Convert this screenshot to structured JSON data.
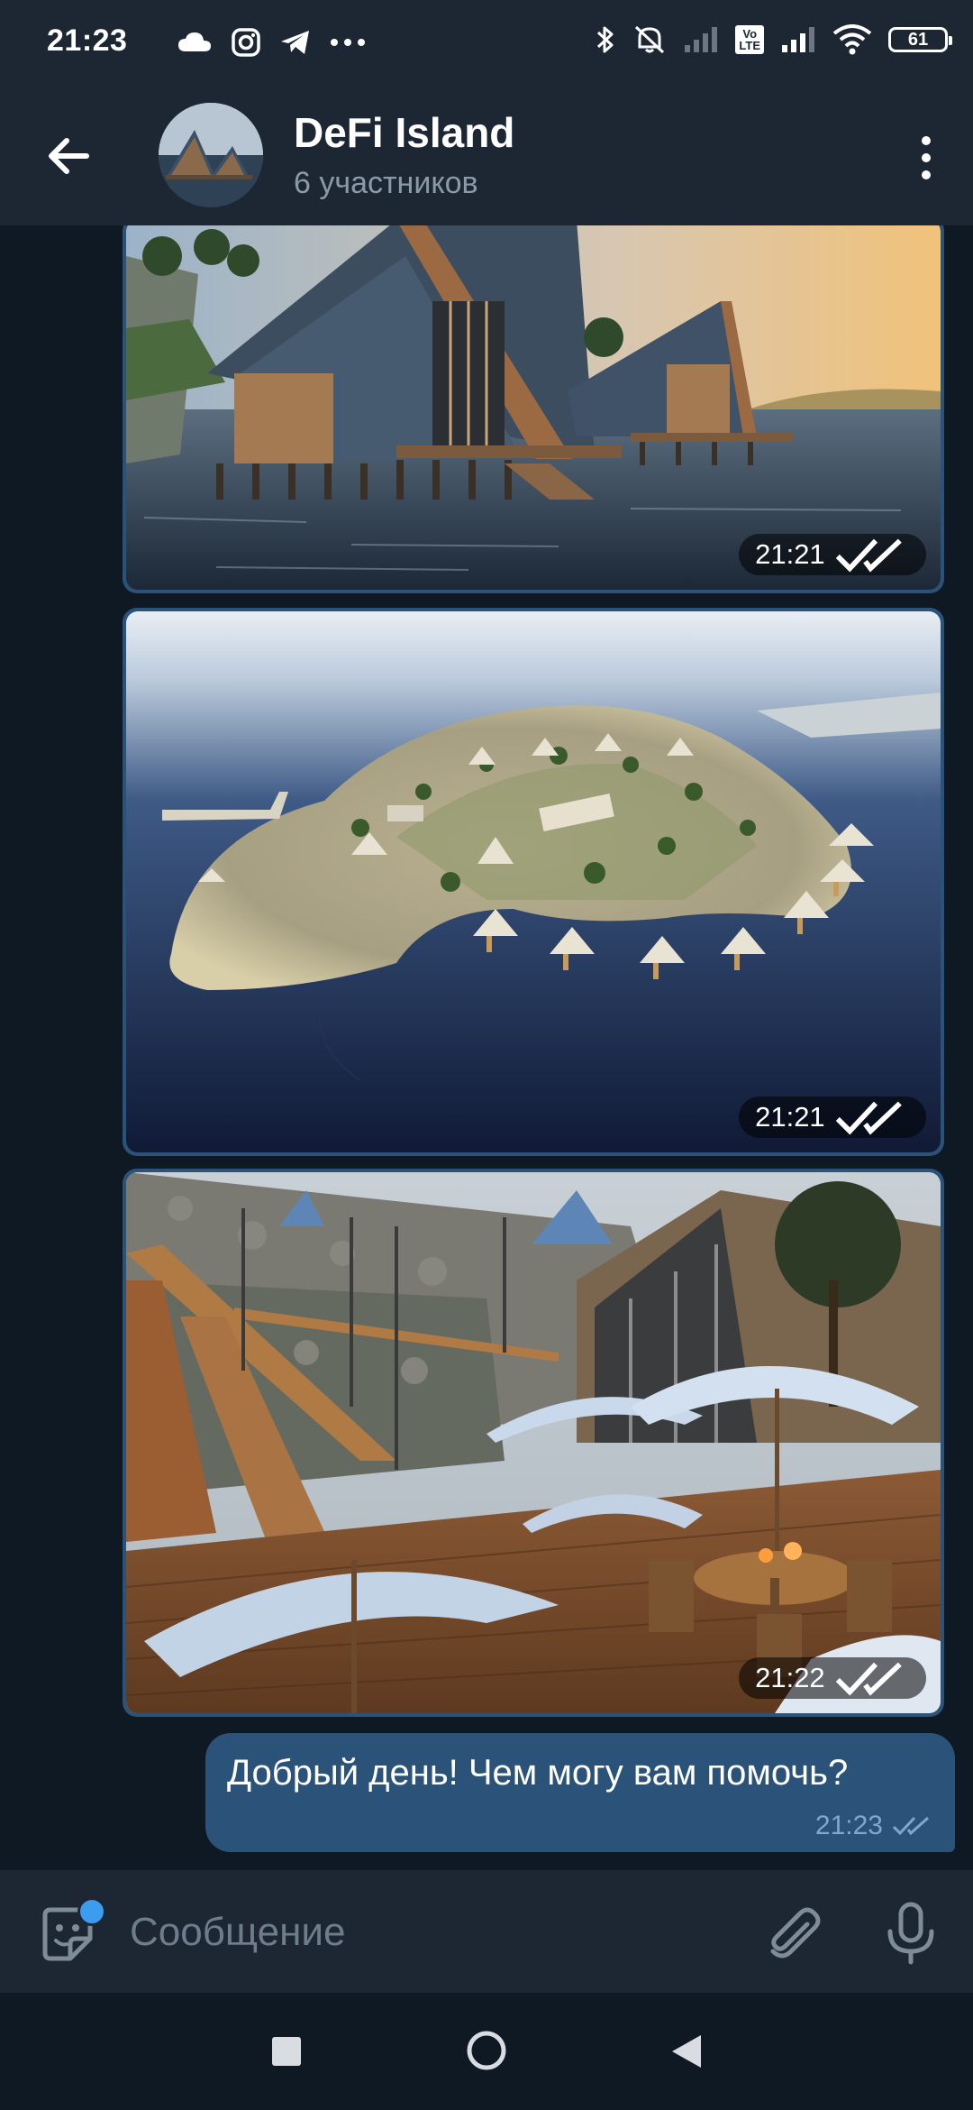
{
  "status_bar": {
    "time": "21:23",
    "left_icons": [
      "cloud-icon",
      "instagram-icon",
      "telegram-icon",
      "more-dots-icon"
    ],
    "right_icons": [
      "bluetooth-icon",
      "silent-mode-icon",
      "signal-icon",
      "volte-icon",
      "signal-icon",
      "wifi-icon"
    ],
    "lte_label": "Vo LTE",
    "battery": "61"
  },
  "header": {
    "title": "DeFi Island",
    "subtitle": "6 участников",
    "back_icon": "arrow-left-icon",
    "menu_icon": "more-vertical-icon"
  },
  "messages": [
    {
      "type": "photo",
      "scene": "lake-houses",
      "time": "21:21",
      "status_icon": "double-check-icon"
    },
    {
      "type": "photo",
      "scene": "island-aerial",
      "time": "21:21",
      "status_icon": "double-check-icon"
    },
    {
      "type": "photo",
      "scene": "terrace-umbrellas",
      "time": "21:22",
      "status_icon": "double-check-icon"
    },
    {
      "type": "text",
      "text": "Добрый день! Чем могу вам помочь?",
      "time": "21:23",
      "status_icon": "double-check-icon"
    }
  ],
  "input_bar": {
    "placeholder": "Сообщение",
    "emoji_icon": "sticker-icon",
    "attach_icon": "paperclip-icon",
    "mic_icon": "microphone-icon"
  },
  "nav_bar": {
    "recents_icon": "square-icon",
    "home_icon": "circle-icon",
    "back_icon": "triangle-back-icon"
  },
  "colors": {
    "background": "#0f1923",
    "header": "#1c2733",
    "outgoing_bubble": "#2b5278",
    "read_check": "#7fa8d1",
    "subtitle": "#8b9aa8"
  }
}
